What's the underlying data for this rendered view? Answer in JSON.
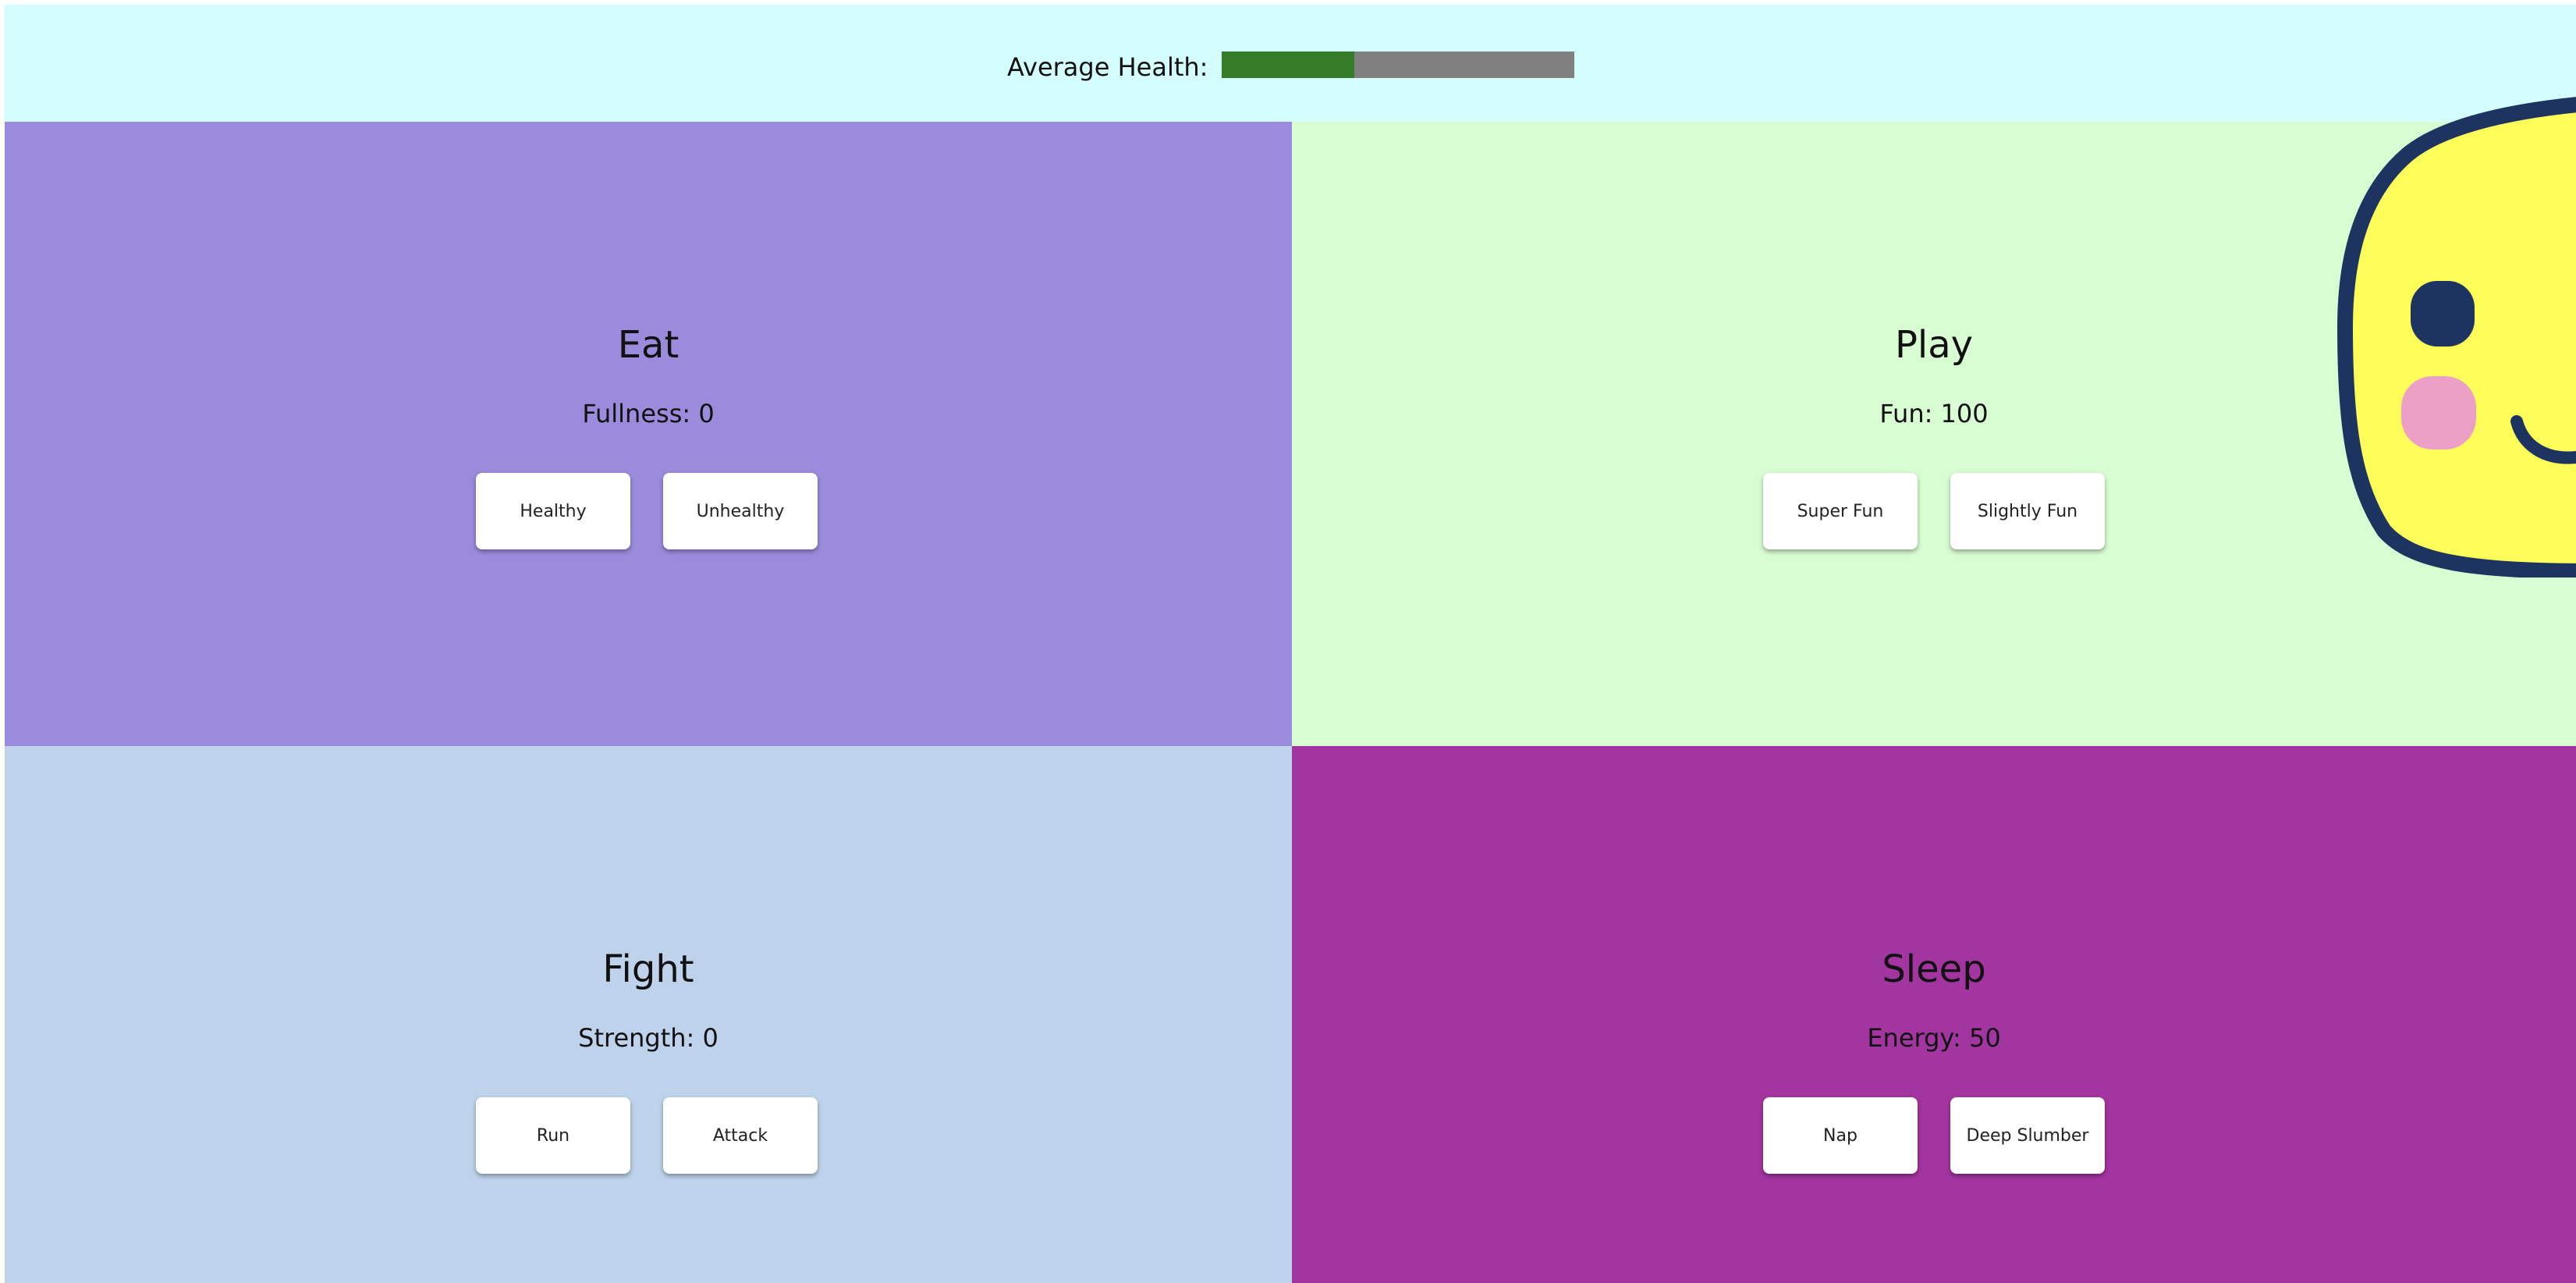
{
  "header": {
    "health_label": "Average Health:",
    "health_value": 0.375,
    "health_fill_color": "#347c27",
    "health_track_color": "#808080"
  },
  "panels": {
    "eat": {
      "title": "Eat",
      "stat": "Fullness: 0",
      "buttons": [
        "Healthy",
        "Unhealthy"
      ],
      "color": "#9b8bdc"
    },
    "play": {
      "title": "Play",
      "stat": "Fun: 100",
      "buttons": [
        "Super Fun",
        "Slightly Fun"
      ],
      "color": "#d9fdd3"
    },
    "fight": {
      "title": "Fight",
      "stat": "Strength: 0",
      "buttons": [
        "Run",
        "Attack"
      ],
      "color": "#bed3eb"
    },
    "sleep": {
      "title": "Sleep",
      "stat": "Energy: 50",
      "buttons": [
        "Nap",
        "Deep Slumber"
      ],
      "color": "#a235a0"
    }
  },
  "pet": {
    "icon": "pet-face-icon",
    "body_color": "#fefe5a",
    "outline_color": "#1d3461",
    "cheek_color": "#eda0c6"
  }
}
